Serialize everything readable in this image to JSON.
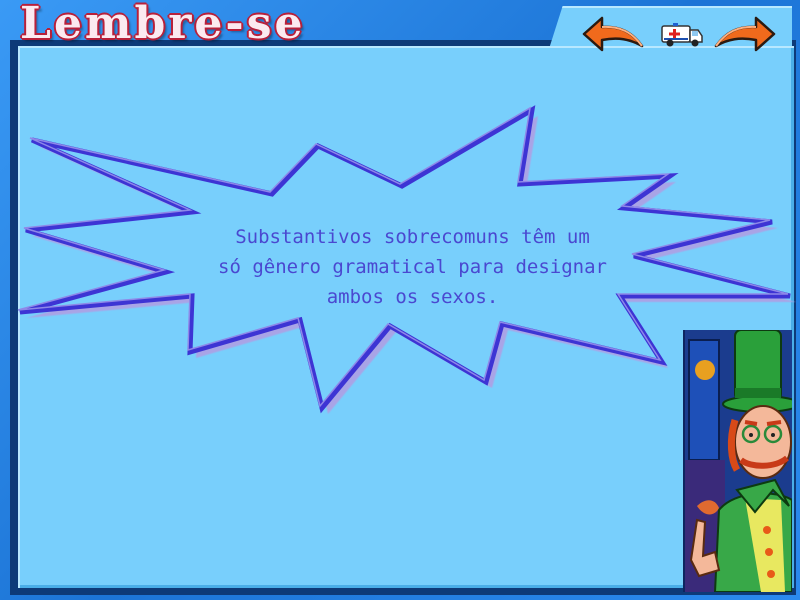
{
  "title": "Lembre-se",
  "nav": {
    "back_icon": "back-arrow-icon",
    "home_icon": "ambulance-icon",
    "forward_icon": "forward-arrow-icon"
  },
  "message": {
    "line1": "Substantivos sobrecomuns têm um",
    "line2": "só gênero gramatical para designar",
    "line3": "ambos os sexos."
  },
  "colors": {
    "panel": "#78cffc",
    "frame": "#1f7fe0",
    "burst_outline": "#3d34d4",
    "text": "#4a48d0",
    "title_outline": "#b8203a",
    "arrow_orange": "#f06a1c"
  }
}
